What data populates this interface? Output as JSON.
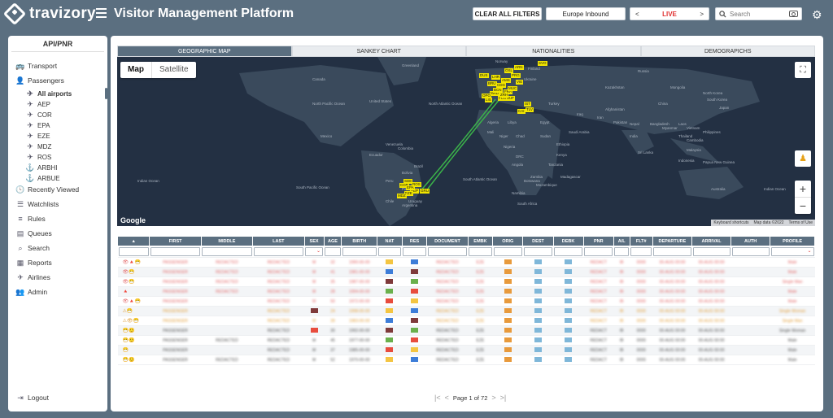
{
  "header": {
    "brand": "travizory",
    "title": "Visitor Management Platform",
    "clear_filters": "CLEAR ALL FILTERS",
    "direction": "Europe Inbound",
    "live": "LIVE",
    "prev": "<",
    "next": ">",
    "search_placeholder": "Search"
  },
  "sidebar": {
    "heading": "API/PNR",
    "items": [
      {
        "label": "Transport",
        "icon": "transport-icon"
      },
      {
        "label": "Passengers",
        "icon": "passengers-icon"
      },
      {
        "label": "Recently Viewed",
        "icon": "recent-icon"
      },
      {
        "label": "Watchlists",
        "icon": "watchlist-icon"
      },
      {
        "label": "Rules",
        "icon": "rules-icon"
      },
      {
        "label": "Queues",
        "icon": "queues-icon"
      },
      {
        "label": "Search",
        "icon": "search-icon"
      },
      {
        "label": "Reports",
        "icon": "reports-icon"
      },
      {
        "label": "Airlines",
        "icon": "plane-icon"
      },
      {
        "label": "Admin",
        "icon": "admin-icon"
      }
    ],
    "airports": [
      "All airports",
      "AEP",
      "COR",
      "EPA",
      "EZE",
      "MDZ",
      "ROS",
      "ARBHI",
      "ARBUE"
    ],
    "logout": "Logout"
  },
  "tabs": [
    "GEOGRAPHIC MAP",
    "SANKEY CHART",
    "NATIONALITIES",
    "DEMOGRAPICHS"
  ],
  "map": {
    "map_label": "Map",
    "satellite_label": "Satellite",
    "google": "Google",
    "attribution": [
      "Keyboard shortcuts",
      "Map data ©2022",
      "Terms of Use"
    ],
    "labels": [
      "North Pacific Ocean",
      "North Atlantic Ocean",
      "South Atlantic Ocean",
      "South Pacific Ocean",
      "Indian Ocean",
      "Indian Ocean",
      "United States",
      "Mexico",
      "Colombia",
      "Brazil",
      "Bolivia",
      "Peru",
      "Chile",
      "Argentina",
      "Ukraine",
      "Algeria",
      "Libya",
      "Egypt",
      "Saudi Arabia",
      "Nigeria",
      "DRC",
      "Kenya",
      "Botswana",
      "Tanzania",
      "Iran",
      "India",
      "China",
      "Mongolia",
      "Japan",
      "Indonesia",
      "Papua New Guinea",
      "Australia",
      "Afghanistan",
      "Pakistan",
      "Kazakhstan",
      "Russia",
      "Norway",
      "Sweden",
      "Finland",
      "Canada",
      "Greenland",
      "Namibia",
      "South Africa",
      "Madagascar",
      "Mozambique",
      "Zambia",
      "Sudan",
      "Ethiopia",
      "Turkey",
      "Iraq",
      "Niger",
      "Mali",
      "Chad",
      "Angola",
      "Venezuela",
      "Ecuador",
      "Paraguay",
      "Uruguay",
      "Thailand",
      "Philippines",
      "Malaysia",
      "Vietnam",
      "Myanmar",
      "Sri Lanka",
      "Nepal",
      "Bangladesh",
      "Laos",
      "Cambodia",
      "South Korea",
      "North Korea"
    ],
    "airport_tags": [
      "MAD",
      "FCO",
      "LIS",
      "BCN",
      "FRA",
      "CDG",
      "AMS",
      "LHR",
      "IST",
      "SVO",
      "SUF",
      "OPO",
      "AEP",
      "EZE",
      "COR",
      "SDE",
      "ROS",
      "MDZ",
      "EPA",
      "GRU",
      "TLV",
      "CAI",
      "ZRH",
      "MUC",
      "BRU",
      "DUS",
      "VIE",
      "PRG",
      "OSL",
      "ARN"
    ]
  },
  "table": {
    "columns": [
      "",
      "FIRST",
      "MIDDLE",
      "LAST",
      "SEX",
      "AGE",
      "BIRTH",
      "NAT",
      "RES",
      "DOCUMENT",
      "EMBK",
      "ORIG",
      "DEST",
      "DEBK",
      "PNR",
      "A/L",
      "FLT#",
      "DEPARTURE",
      "ARRIVAL",
      "AUTH",
      "PROFILE"
    ],
    "rows": [
      {
        "status": "r",
        "icons": "👁🔺😷",
        "first": "PASSENGER",
        "middle": "REDACTED",
        "last": "REDACTED",
        "sex": "M",
        "age": "32",
        "birth": "1990-00-00",
        "doc": "REDACTED",
        "embk": "EZE",
        "orig": "MAD",
        "dest": "EZE",
        "debk": "EZE",
        "pnr": "REDACT",
        "al": "IB",
        "flt": "0000",
        "dep": "00-AUG 00:00",
        "arr": "00-AUG 00:00",
        "auth": "",
        "profile": "Male"
      },
      {
        "status": "r",
        "icons": "👁😷",
        "first": "PASSENGER",
        "middle": "REDACTED",
        "last": "REDACTED",
        "sex": "M",
        "age": "41",
        "birth": "1981-00-00",
        "doc": "REDACTED",
        "embk": "EZE",
        "orig": "MAD",
        "dest": "EZE",
        "debk": "EZE",
        "pnr": "REDACT",
        "al": "IB",
        "flt": "0000",
        "dep": "00-AUG 00:00",
        "arr": "00-AUG 00:00",
        "auth": "",
        "profile": "Male"
      },
      {
        "status": "r",
        "icons": "👁😷",
        "first": "PASSENGER",
        "middle": "REDACTED",
        "last": "REDACTED",
        "sex": "M",
        "age": "35",
        "birth": "1987-00-00",
        "doc": "REDACTED",
        "embk": "EZE",
        "orig": "MAD",
        "dest": "EZE",
        "debk": "EZE",
        "pnr": "REDACT",
        "al": "IB",
        "flt": "0000",
        "dep": "00-AUG 00:00",
        "arr": "00-AUG 00:00",
        "auth": "",
        "profile": "Single Man"
      },
      {
        "status": "r",
        "icons": "🔺",
        "first": "PASSENGER",
        "middle": "REDACTED",
        "last": "REDACTED",
        "sex": "M",
        "age": "28",
        "birth": "1994-00-00",
        "doc": "REDACTED",
        "embk": "EZE",
        "orig": "MAD",
        "dest": "EZE",
        "debk": "EZE",
        "pnr": "REDACT",
        "al": "IB",
        "flt": "0000",
        "dep": "00-AUG 00:00",
        "arr": "00-AUG 00:00",
        "auth": "",
        "profile": "Male"
      },
      {
        "status": "r",
        "icons": "👁🔺😷",
        "first": "PASSENGER",
        "middle": "",
        "last": "REDACTED",
        "sex": "M",
        "age": "50",
        "birth": "1972-00-00",
        "doc": "REDACTED",
        "embk": "EZE",
        "orig": "MAD",
        "dest": "EZE",
        "debk": "EZE",
        "pnr": "REDACT",
        "al": "IB",
        "flt": "0000",
        "dep": "00-AUG 00:00",
        "arr": "00-AUG 00:00",
        "auth": "",
        "profile": "Male"
      },
      {
        "status": "o",
        "icons": "⚠😷",
        "first": "PASSENGER",
        "middle": "",
        "last": "REDACTED",
        "sex": "F",
        "age": "24",
        "birth": "1998-00-00",
        "doc": "REDACTED",
        "embk": "EZE",
        "orig": "MAD",
        "dest": "EZE",
        "debk": "EZE",
        "pnr": "REDACT",
        "al": "IB",
        "flt": "0000",
        "dep": "00-AUG 00:00",
        "arr": "00-AUG 00:00",
        "auth": "",
        "profile": "Single Woman"
      },
      {
        "status": "o",
        "icons": "⚠👁😷",
        "first": "PASSENGER",
        "middle": "",
        "last": "REDACTED",
        "sex": "M",
        "age": "39",
        "birth": "1983-00-00",
        "doc": "REDACTED",
        "embk": "EZE",
        "orig": "MAD",
        "dest": "EZE",
        "debk": "EZE",
        "pnr": "REDACT",
        "al": "IB",
        "flt": "0000",
        "dep": "00-AUG 00:00",
        "arr": "00-AUG 00:00",
        "auth": "",
        "profile": "Single Man"
      },
      {
        "status": "g",
        "icons": "😷🙂",
        "first": "PASSENGER",
        "middle": "",
        "last": "REDACTED",
        "sex": "F",
        "age": "30",
        "birth": "1992-00-00",
        "doc": "REDACTED",
        "embk": "EZE",
        "orig": "MAD",
        "dest": "EZE",
        "debk": "EZE",
        "pnr": "REDACT",
        "al": "IB",
        "flt": "0000",
        "dep": "00-AUG 00:00",
        "arr": "00-AUG 00:00",
        "auth": "",
        "profile": "Single Woman"
      },
      {
        "status": "g",
        "icons": "😷🙂",
        "first": "PASSENGER",
        "middle": "REDACTED",
        "last": "REDACTED",
        "sex": "M",
        "age": "45",
        "birth": "1977-00-00",
        "doc": "REDACTED",
        "embk": "EZE",
        "orig": "MAD",
        "dest": "EZE",
        "debk": "EZE",
        "pnr": "REDACT",
        "al": "IB",
        "flt": "0000",
        "dep": "00-AUG 00:00",
        "arr": "00-AUG 00:00",
        "auth": "",
        "profile": "Male"
      },
      {
        "status": "g",
        "icons": "😷",
        "first": "PASSENGER",
        "middle": "",
        "last": "REDACTED",
        "sex": "M",
        "age": "37",
        "birth": "1985-00-00",
        "doc": "REDACTED",
        "embk": "EZE",
        "orig": "MAD",
        "dest": "EZE",
        "debk": "EZE",
        "pnr": "REDACT",
        "al": "IB",
        "flt": "0000",
        "dep": "00-AUG 00:00",
        "arr": "00-AUG 00:00",
        "auth": "",
        "profile": "Male"
      },
      {
        "status": "g",
        "icons": "😷🙂",
        "first": "PASSENGER",
        "middle": "REDACTED",
        "last": "REDACTED",
        "sex": "M",
        "age": "52",
        "birth": "1970-00-00",
        "doc": "REDACTED",
        "embk": "EZE",
        "orig": "MAD",
        "dest": "EZE",
        "debk": "EZE",
        "pnr": "REDACT",
        "al": "IB",
        "flt": "0000",
        "dep": "00-AUG 00:00",
        "arr": "00-AUG 00:00",
        "auth": "",
        "profile": "Male"
      }
    ]
  },
  "pager": {
    "text": "Page 1 of 72",
    "first": "|<",
    "prev": "<",
    "next": ">",
    "last": ">|"
  },
  "colors": {
    "header": "#5b6f80",
    "alert": "#e03030",
    "warning": "#e2a03f",
    "route": "#3bb34a",
    "airport_tag": "#f2e600"
  }
}
